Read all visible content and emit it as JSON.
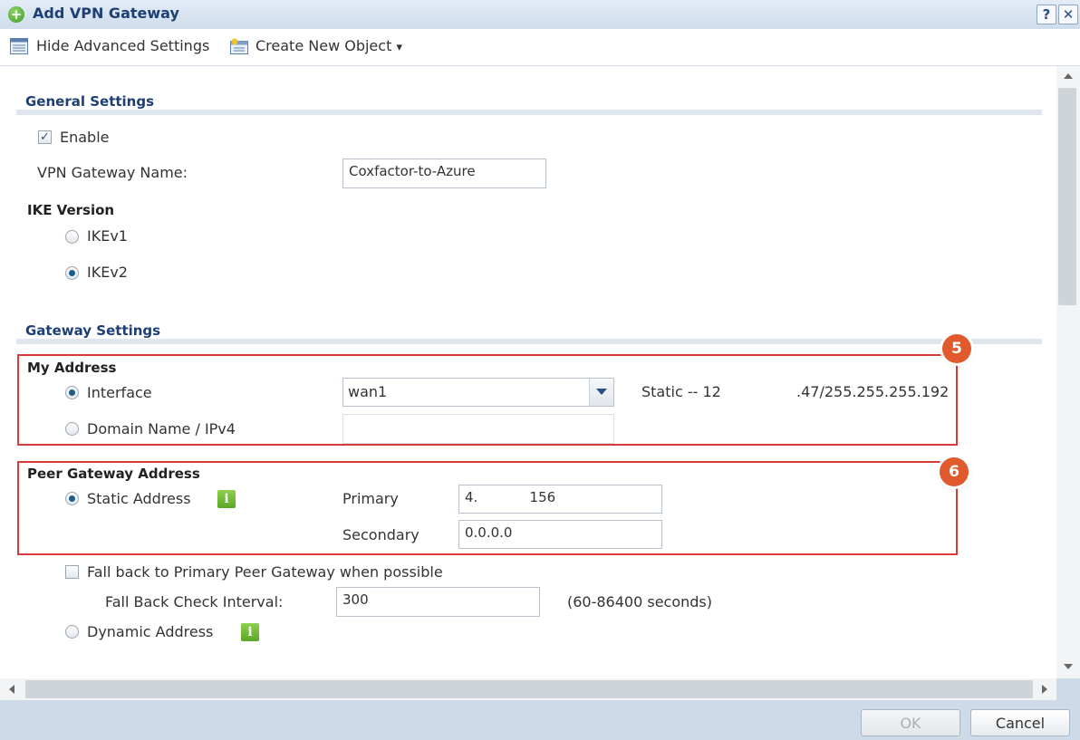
{
  "window": {
    "title": "Add VPN Gateway",
    "help_label": "?",
    "close_label": "✕"
  },
  "toolbar": {
    "hide_advanced": "Hide Advanced Settings",
    "create_object": "Create New Object",
    "create_object_caret": "▾"
  },
  "general": {
    "section_title": "General Settings",
    "enable_label": "Enable",
    "enable_checked": true,
    "gateway_name_label": "VPN Gateway Name:",
    "gateway_name_value": "Coxfactor-to-Azure",
    "ike_version_title": "IKE Version",
    "ikev1_label": "IKEv1",
    "ikev2_label": "IKEv2",
    "ike_selected": "IKEv2"
  },
  "gateway": {
    "section_title": "Gateway Settings",
    "my_address": {
      "title": "My Address",
      "badge": "5",
      "interface_label": "Interface",
      "interface_value": "wan1",
      "interface_status": "Static -- 12",
      "interface_address": ".47/255.255.255.192",
      "domain_label": "Domain Name / IPv4",
      "domain_value": ""
    },
    "peer": {
      "title": "Peer Gateway Address",
      "badge": "6",
      "static_label": "Static Address",
      "primary_label": "Primary",
      "primary_value": "4.            156",
      "secondary_label": "Secondary",
      "secondary_value": "0.0.0.0"
    },
    "fallback_label": "Fall back to Primary Peer Gateway when possible",
    "fallback_interval_label": "Fall Back Check Interval:",
    "fallback_interval_value": "300",
    "fallback_range": "(60-86400 seconds)",
    "dynamic_label": "Dynamic Address"
  },
  "footer": {
    "ok_label": "OK",
    "cancel_label": "Cancel"
  },
  "colors": {
    "accent": "#1e3f74",
    "highlight_box": "#d93a3a",
    "badge": "#e05a2e"
  }
}
